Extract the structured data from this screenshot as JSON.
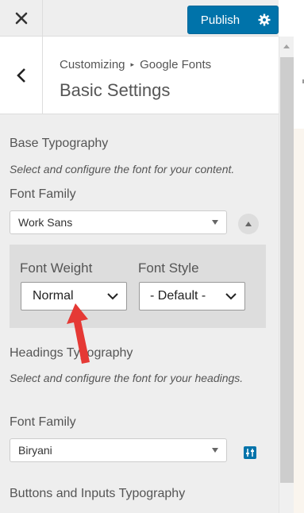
{
  "topbar": {
    "close_icon": "close-icon",
    "publish_label": "Publish",
    "settings_icon": "gear-icon",
    "accent": "#0073aa"
  },
  "header": {
    "breadcrumb_parent": "Customizing",
    "breadcrumb_separator": "▸",
    "breadcrumb_current": "Google Fonts",
    "title": "Basic Settings",
    "back_icon": "chevron-left-icon"
  },
  "base": {
    "title": "Base Typography",
    "description": "Select and configure the font for your content.",
    "font_family_label": "Font Family",
    "font_family_value": "Work Sans",
    "font_weight_label": "Font Weight",
    "font_weight_value": "Normal",
    "font_style_label": "Font Style",
    "font_style_value": "- Default -"
  },
  "headings": {
    "title": "Headings Typography",
    "description": "Select and configure the font for your headings.",
    "font_family_label": "Font Family",
    "font_family_value": "Biryani"
  },
  "buttons": {
    "title": "Buttons and Inputs Typography"
  },
  "annotation": {
    "arrow_color": "#e53935"
  }
}
